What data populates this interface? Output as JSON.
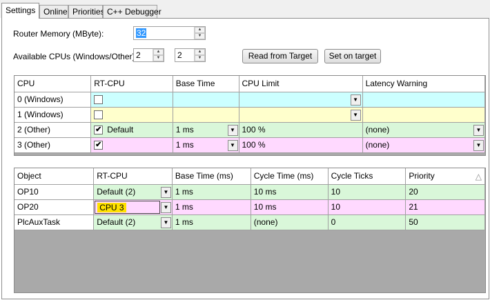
{
  "tabs": [
    "Settings",
    "Online",
    "Priorities",
    "C++ Debugger"
  ],
  "form": {
    "router_memory_label": "Router Memory (MByte):",
    "router_memory_value": "32",
    "available_cpus_label": "Available CPUs (Windows/Other):",
    "cpus_windows": "2",
    "cpus_other": "2",
    "read_button": "Read from Target",
    "set_button": "Set on target"
  },
  "cpu_grid": {
    "headers": [
      "CPU",
      "RT-CPU",
      "Base Time",
      "CPU Limit",
      "Latency Warning"
    ],
    "rows": [
      {
        "cpu": "0 (Windows)",
        "checked": "",
        "rt_label": "",
        "base": "",
        "limit": "",
        "latency": ""
      },
      {
        "cpu": "1 (Windows)",
        "checked": "",
        "rt_label": "",
        "base": "",
        "limit": "",
        "latency": ""
      },
      {
        "cpu": "2 (Other)",
        "checked": "✔",
        "rt_label": "Default",
        "base": "1 ms",
        "limit": "100 %",
        "latency": "(none)"
      },
      {
        "cpu": "3 (Other)",
        "checked": "✔",
        "rt_label": "",
        "base": "1 ms",
        "limit": "100 %",
        "latency": "(none)"
      }
    ]
  },
  "task_grid": {
    "headers": [
      "Object",
      "RT-CPU",
      "Base Time (ms)",
      "Cycle Time (ms)",
      "Cycle Ticks",
      "Priority"
    ],
    "rows": [
      {
        "object": "OP10",
        "rt": "Default (2)",
        "base": "1 ms",
        "cycle": "10 ms",
        "ticks": "10",
        "priority": "20"
      },
      {
        "object": "OP20",
        "rt": "CPU 3",
        "base": "1 ms",
        "cycle": "10 ms",
        "ticks": "10",
        "priority": "21"
      },
      {
        "object": "PlcAuxTask",
        "rt": "Default (2)",
        "base": "1 ms",
        "cycle": "(none)",
        "ticks": "0",
        "priority": "50"
      }
    ]
  },
  "icons": {
    "dropdown": "▼",
    "sort": "△",
    "spin_up": "▲",
    "spin_down": "▼"
  }
}
